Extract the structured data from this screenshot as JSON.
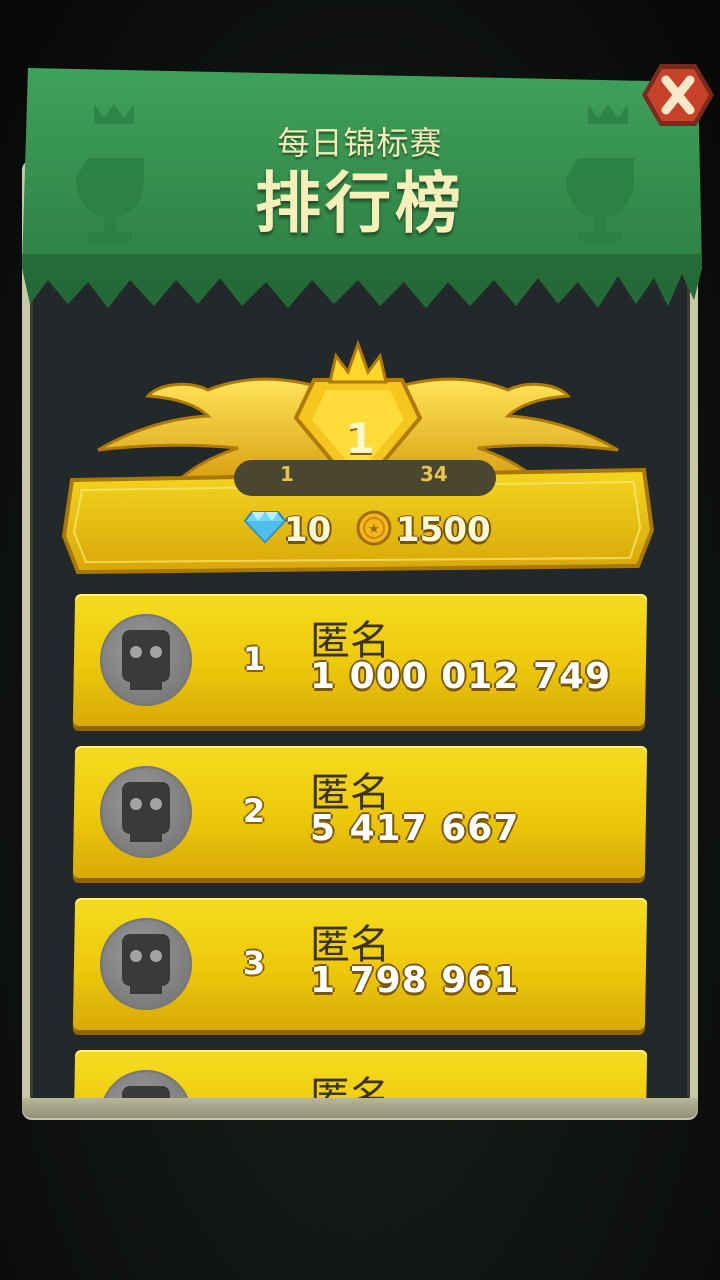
{
  "header": {
    "subtitle": "每日锦标赛",
    "title": "排行榜"
  },
  "close_button": {
    "icon": "close-icon"
  },
  "player_rank": {
    "rank": "1",
    "bar_left": "1",
    "bar_right": "34",
    "rewards": {
      "gems": "10",
      "gem_icon": "diamond-icon",
      "coins": "1500",
      "coin_icon": "coin-icon"
    }
  },
  "leaderboard": {
    "entries": [
      {
        "rank": "1",
        "name": "匿名",
        "score": "1 000 012 749"
      },
      {
        "rank": "2",
        "name": "匿名",
        "score": "5 417 667"
      },
      {
        "rank": "3",
        "name": "匿名",
        "score": "1 798 961"
      },
      {
        "rank": "",
        "name": "匿名",
        "score": ""
      }
    ]
  },
  "colors": {
    "banner_green": "#2f8a4a",
    "row_gold": "#edc80c",
    "panel_dark": "#23282a",
    "close_red": "#c8422a"
  }
}
